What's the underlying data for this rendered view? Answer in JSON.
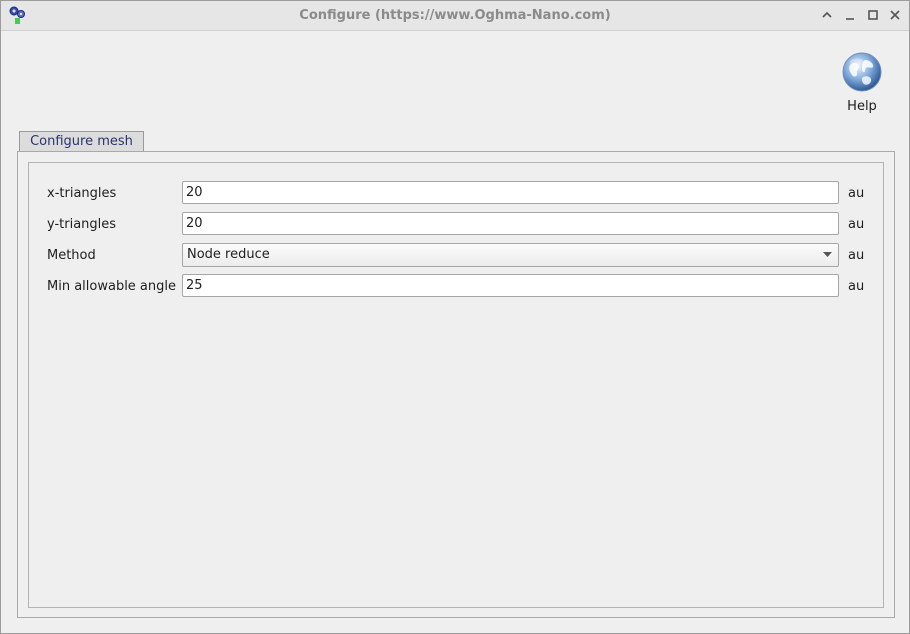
{
  "window": {
    "title": "Configure (https://www.Oghma-Nano.com)",
    "icon": "oghma-app-icon",
    "controls": [
      "collapse-icon",
      "minimize-icon",
      "maximize-icon",
      "close-icon"
    ]
  },
  "toolbar": {
    "help_label": "Help",
    "help_icon": "globe-icon"
  },
  "tabs": [
    {
      "label": "Configure mesh",
      "selected": true
    }
  ],
  "form": {
    "rows": [
      {
        "label": "x-triangles",
        "value": "20",
        "unit": "au",
        "type": "text"
      },
      {
        "label": "y-triangles",
        "value": "20",
        "unit": "au",
        "type": "text"
      },
      {
        "label": "Method",
        "value": "Node reduce",
        "unit": "au",
        "type": "select"
      },
      {
        "label": "Min allowable angle",
        "value": "25",
        "unit": "au",
        "type": "text"
      }
    ]
  },
  "colors": {
    "tab_accent": "#3b4f8c",
    "tab_text": "#28356e",
    "title_text": "#8a8a8a"
  }
}
